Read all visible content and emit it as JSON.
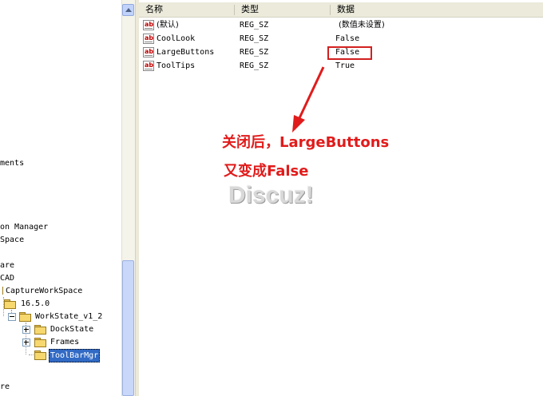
{
  "tree": {
    "items": [
      {
        "label": "ments"
      },
      {
        "label": "on Manager"
      },
      {
        "label": "Space"
      },
      {
        "label": "are"
      },
      {
        "label": "CAD"
      },
      {
        "label": "CaptureWorkSpace"
      },
      {
        "label": "16.5.0"
      },
      {
        "label": "WorkState_v1_2"
      },
      {
        "label": "DockState"
      },
      {
        "label": "Frames"
      },
      {
        "label": "ToolBarMgr"
      },
      {
        "label": "re"
      }
    ]
  },
  "list": {
    "columns": {
      "name": "名称",
      "type": "类型",
      "data": "数据"
    },
    "rows": [
      {
        "name": "(默认)",
        "type": "REG_SZ",
        "data": "(数值未设置)"
      },
      {
        "name": "CoolLook",
        "type": "REG_SZ",
        "data": "False"
      },
      {
        "name": "LargeButtons",
        "type": "REG_SZ",
        "data": "False"
      },
      {
        "name": "ToolTips",
        "type": "REG_SZ",
        "data": "True"
      }
    ]
  },
  "annotation": {
    "line1": "关闭后，LargeButtons",
    "line2": "又变成False",
    "color": "#e11b1b"
  },
  "watermark": "Discuz!"
}
